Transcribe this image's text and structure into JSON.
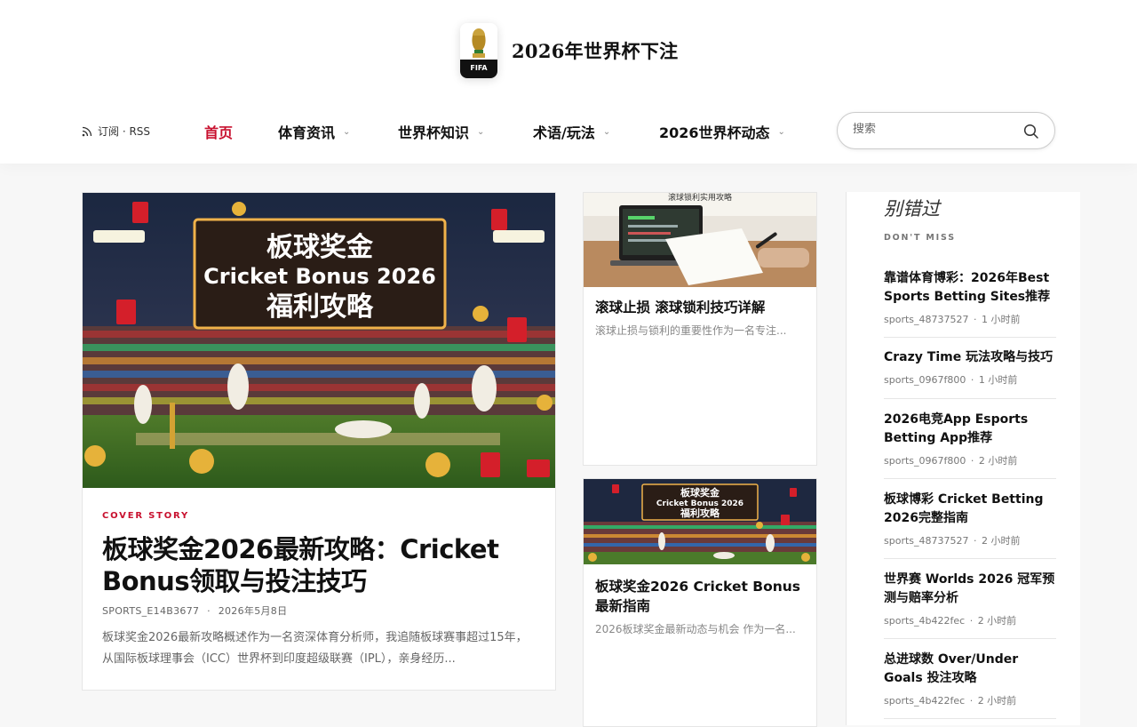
{
  "site": {
    "title": "2026年世界杯下注",
    "logo_text": "FIFA"
  },
  "header": {
    "rss_label": "订阅 · RSS",
    "nav": [
      {
        "label": "首页",
        "active": true,
        "dropdown": false
      },
      {
        "label": "体育资讯",
        "active": false,
        "dropdown": true
      },
      {
        "label": "世界杯知识",
        "active": false,
        "dropdown": true
      },
      {
        "label": "术语/玩法",
        "active": false,
        "dropdown": true
      },
      {
        "label": "2026世界杯动态",
        "active": false,
        "dropdown": true
      }
    ],
    "search_placeholder": "搜索"
  },
  "feature": {
    "image_text": {
      "line1": "板球奖金",
      "line2": "Cricket Bonus 2026",
      "line3": "福利攻略"
    },
    "kicker": "COVER STORY",
    "title": "板球奖金2026最新攻略：Cricket Bonus领取与投注技巧",
    "author": "SPORTS_E14B3677",
    "date": "2026年5月8日",
    "meta_separator": "·",
    "excerpt": "板球奖金2026最新攻略概述作为一名资深体育分析师，我追随板球赛事超过15年，从国际板球理事会（ICC）世界杯到印度超级联赛（IPL），亲身经历..."
  },
  "posts": [
    {
      "image_caption": "滚球锁利实用攻略",
      "title": "滚球止损 滚球锁利技巧详解",
      "excerpt": "滚球止损与锁利的重要性作为一名专注..."
    },
    {
      "image_text": {
        "line1": "板球奖金",
        "line2": "Cricket Bonus 2026",
        "line3": "福利攻略"
      },
      "title": "板球奖金2026 Cricket Bonus最新指南",
      "excerpt": "2026板球奖金最新动态与机会 作为一名..."
    }
  ],
  "sidebar": {
    "heading": "别错过",
    "subheading": "DON'T MISS",
    "items": [
      {
        "title": "靠谱体育博彩：2026年Best Sports Betting Sites推荐",
        "author": "sports_48737527",
        "time": "1 小时前"
      },
      {
        "title": "Crazy Time 玩法攻略与技巧",
        "author": "sports_0967f800",
        "time": "1 小时前"
      },
      {
        "title": "2026电竞App Esports Betting App推荐",
        "author": "sports_0967f800",
        "time": "2 小时前"
      },
      {
        "title": "板球博彩 Cricket Betting 2026完整指南",
        "author": "sports_48737527",
        "time": "2 小时前"
      },
      {
        "title": "世界赛 Worlds 2026 冠军预测与赔率分析",
        "author": "sports_4b422fec",
        "time": "2 小时前"
      },
      {
        "title": "总进球数 Over/Under Goals 投注攻略",
        "author": "sports_4b422fec",
        "time": "2 小时前"
      }
    ],
    "meta_separator": "·"
  },
  "colors": {
    "accent": "#c8102e",
    "text": "#111111",
    "muted": "#666666",
    "border": "#e6e6e6"
  },
  "icons": {
    "rss": "rss-icon",
    "search": "search-icon",
    "chevron": "chevron-down-icon"
  }
}
